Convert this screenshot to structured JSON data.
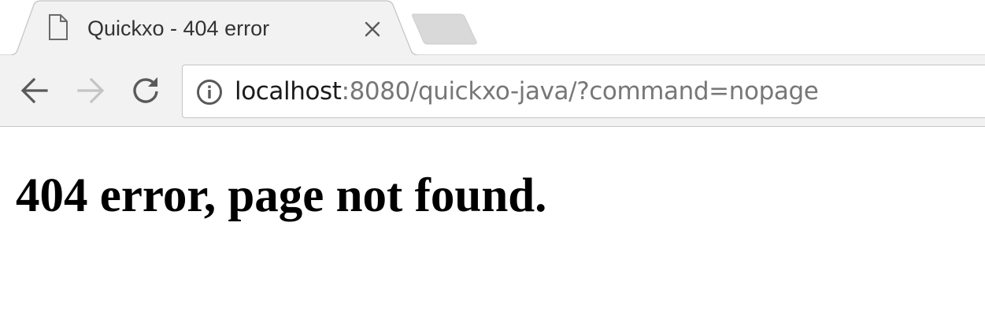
{
  "tab": {
    "title": "Quickxo - 404 error",
    "icon": "page-icon",
    "close_icon": "close-icon"
  },
  "new_tab": {
    "icon": "new-tab-icon"
  },
  "toolbar": {
    "back_icon": "arrow-left-icon",
    "forward_icon": "arrow-right-icon",
    "reload_icon": "reload-icon",
    "forward_enabled": false
  },
  "address_bar": {
    "security_icon": "info-icon",
    "host": "localhost",
    "rest": ":8080/quickxo-java/?command=nopage"
  },
  "page": {
    "heading": "404 error, page not found."
  },
  "colors": {
    "tab_strip_bg": "#ffffff",
    "active_tab_bg": "#f2f2f2",
    "toolbar_bg": "#f2f2f2",
    "inactive_tab": "#d9d9d9",
    "url_host": "#1b1b1b",
    "url_rest": "#777777",
    "icon": "#5a5a5a",
    "icon_disabled": "#c0c0c0"
  }
}
